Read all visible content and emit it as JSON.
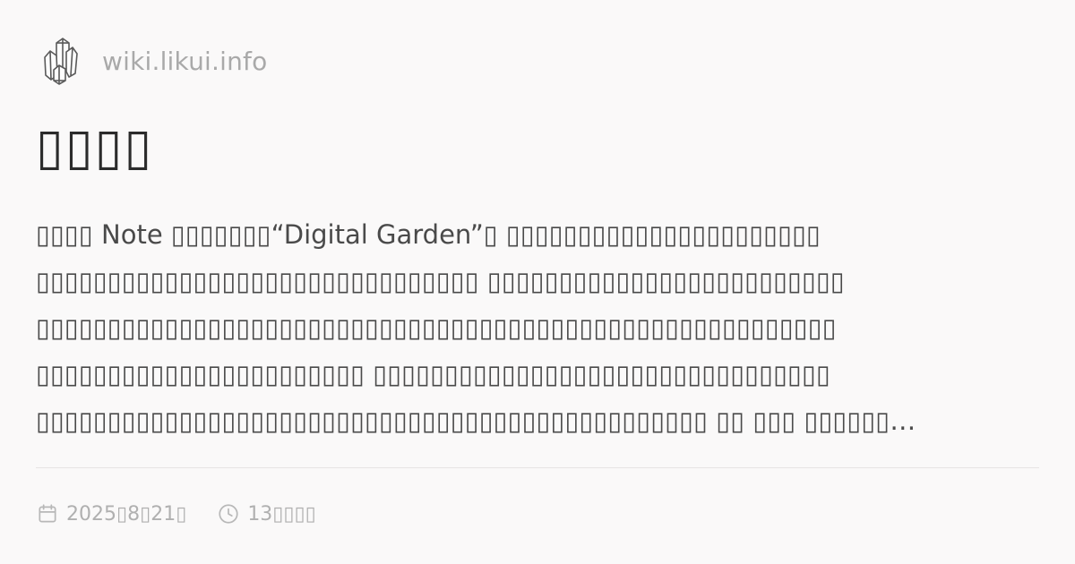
{
  "site": {
    "name": "wiki.likui.info",
    "logo_icon": "crystal-cluster-icon"
  },
  "article": {
    "title": "▯▯▯▯",
    "excerpt_lines": [
      "▯▯▯▯ Note ▯▯▯▯▯▯▯“Digital Garden”▯ ▯▯▯▯▯▯▯▯▯▯▯▯▯▯▯▯▯▯▯▯▯▯",
      "▯▯▯▯▯▯▯▯▯▯▯▯▯▯▯▯▯▯▯▯▯▯▯▯▯▯▯▯▯▯▯ ▯▯▯▯▯▯▯▯▯▯▯▯▯▯▯▯▯▯▯▯▯▯▯▯▯",
      "▯▯▯▯▯▯▯▯▯▯▯▯▯▯▯▯▯▯▯▯▯▯▯▯▯▯▯▯▯▯▯▯▯▯▯▯▯▯▯▯▯▯▯▯▯▯▯▯▯▯▯▯▯▯▯▯",
      "▯▯▯▯▯▯▯▯▯▯▯▯▯▯▯▯▯▯▯▯▯▯▯ ▯▯▯▯▯▯▯▯▯▯▯▯▯▯▯▯▯▯▯▯▯▯▯▯▯▯▯▯▯▯▯▯",
      "▯▯▯▯▯▯▯▯▯▯▯▯▯▯▯▯▯▯▯▯▯▯▯▯▯▯▯▯▯▯▯▯▯▯▯▯▯▯▯▯▯▯▯▯▯▯▯ ▯▯ ▯▯▯ ▯▯▯▯▯▯…"
    ]
  },
  "meta": {
    "date": "2025▯8▯21▯",
    "date_icon": "calendar-icon",
    "reading_time": "13▯▯▯▯",
    "reading_time_icon": "clock-icon"
  },
  "colors": {
    "background": "#faf9f9",
    "title": "#2b2b2b",
    "body_text": "#4a4a4a",
    "muted": "#b0b0b0",
    "divider": "#e6e4e4"
  }
}
